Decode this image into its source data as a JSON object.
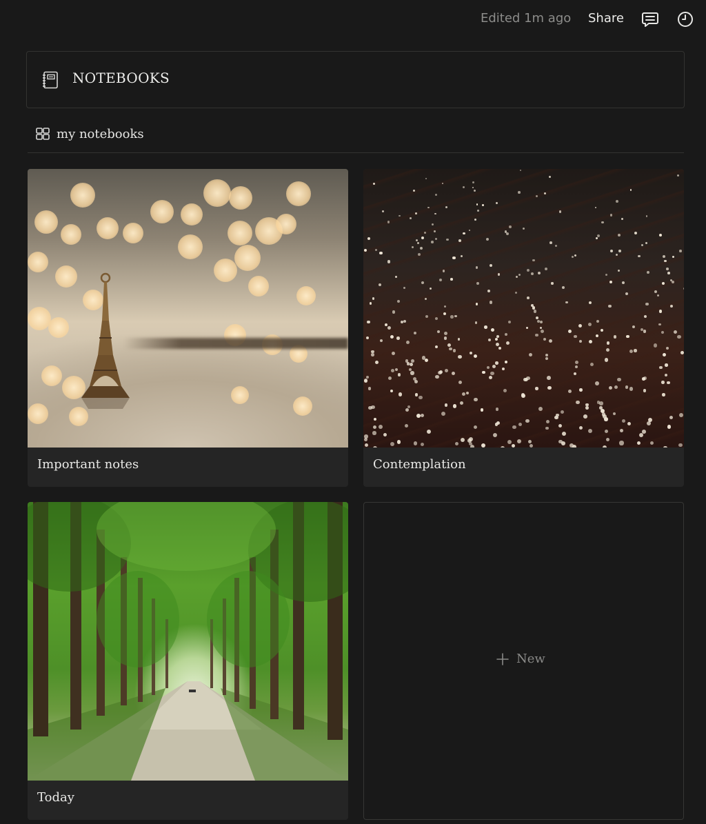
{
  "topbar": {
    "edited_label": "Edited 1m ago",
    "share_label": "Share",
    "comment_icon": "comment-icon",
    "history_icon": "clock-icon"
  },
  "header": {
    "icon": "notebook-icon",
    "title": "NOTEBOOKS"
  },
  "view": {
    "icon": "gallery-icon",
    "label": "my notebooks"
  },
  "cards": [
    {
      "title": "Important notes",
      "cover": "eiffel-tower-bokeh-image"
    },
    {
      "title": "Contemplation",
      "cover": "star-lights-image"
    },
    {
      "title": "Today",
      "cover": "tree-lined-path-image"
    }
  ],
  "new_card": {
    "icon": "plus-icon",
    "label": "New"
  },
  "colors": {
    "background": "#191919",
    "card": "#252525",
    "border": "#333331",
    "text": "#e9e9e7",
    "muted": "#8c8c8a"
  }
}
